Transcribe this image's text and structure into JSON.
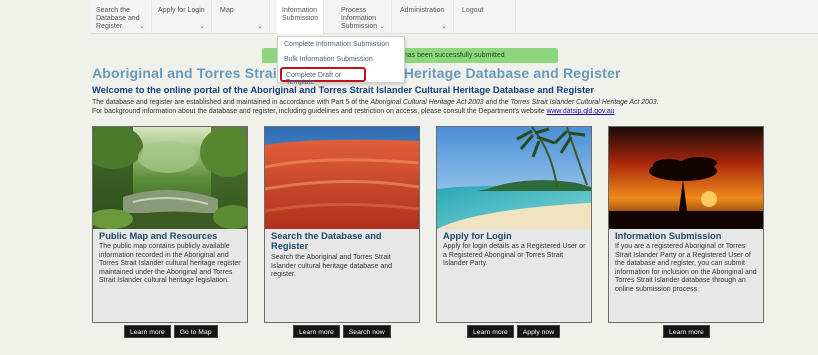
{
  "nav": {
    "items": [
      {
        "label": "Search the Database and Register",
        "has_dropdown": true
      },
      {
        "label": "Apply for Login",
        "has_dropdown": false
      },
      {
        "label": "Map",
        "has_dropdown": true
      },
      {
        "label": "Information Submission",
        "has_dropdown": true
      },
      {
        "label": "Process Information Submission",
        "has_dropdown": true
      },
      {
        "label": "Administration",
        "has_dropdown": true
      },
      {
        "label": "Logout",
        "has_dropdown": false
      }
    ]
  },
  "dropdown": {
    "items": [
      {
        "label": "Complete Information Submission"
      },
      {
        "label": "Bulk Information Submission"
      },
      {
        "label": "Complete Draft or Template",
        "highlighted": true
      }
    ]
  },
  "banner": {
    "success_text": "n has been successfully submitted",
    "color": "#8fd77e"
  },
  "main": {
    "headline": "Aboriginal and Torres Strait Islander Cultural Heritage Database and Register",
    "welcome": "Welcome to the online portal of the Aboriginal and Torres Strait Islander Cultural Heritage Database and Register",
    "intro_part1": "The database and register are established and maintained in accordance with Part 5 of the ",
    "intro_act1": "Aboriginal Cultural Heritage Act 2003",
    "intro_and": " and the ",
    "intro_act2": "Torres Strait Islander Cultural Heritage Act 2003",
    "intro_part2": ".",
    "intro_line2": "For background information about the database and register, including guidelines and restriction on access, please consult the Department's website ",
    "intro_link": "www.datsip.qld.gov.au"
  },
  "cards": [
    {
      "title": "Public Map and Resources",
      "description": "The public map contains publicly available information recorded in the Aboriginal and Torres Strait Islander cultural heritage register maintained under the Aboriginal and Torres Strait Islander cultural heritage legislation.",
      "buttons": [
        "Learn more",
        "Go to Map"
      ]
    },
    {
      "title": "Search the Database and Register",
      "description": "Search the Aboriginal and Torres Strait Islander cultural heritage database and register.",
      "buttons": [
        "Learn more",
        "Search now"
      ]
    },
    {
      "title": "Apply for Login",
      "description": "Apply for login details as a Registered User or a Registered Aboriginal or Torres Strait Islander Party.",
      "buttons": [
        "Learn more",
        "Apply now"
      ]
    },
    {
      "title": "Information Submission",
      "description": "If you are a registered Aboriginal or Torres Strait Islander Party or a Registered User of the database and register, you can submit information for inclusion on the Aboriginal and Torres Strait Islander database through an online submission process.",
      "buttons": [
        "Learn more"
      ]
    }
  ],
  "colors": {
    "headline": "#6699bb",
    "welcome": "#173f7c",
    "card_title": "#1d4a6b",
    "highlight_border": "#c0121c"
  }
}
